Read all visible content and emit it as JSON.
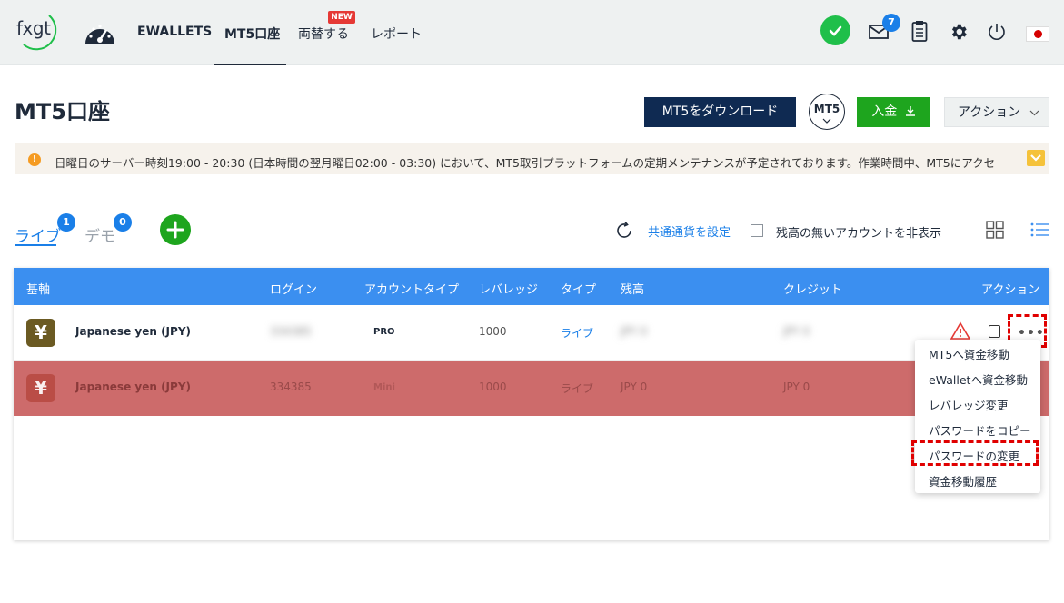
{
  "nav": {
    "logo_text": "fxgt",
    "items": [
      {
        "label": "EWALLETS"
      },
      {
        "label": "MT5口座"
      },
      {
        "label": "両替する"
      },
      {
        "label": "レポート"
      }
    ],
    "new_badge": "NEW",
    "mail_count": "7",
    "icons": [
      "dashboard-icon",
      "check-icon",
      "mail-icon",
      "clipboard-icon",
      "gear-icon",
      "power-icon",
      "japan-flag-icon"
    ]
  },
  "header": {
    "title": "MT5口座",
    "download_label": "MT5をダウンロード",
    "mt5_label": "MT5",
    "deposit_label": "入金",
    "action_label": "アクション"
  },
  "notice": {
    "text": "日曜日のサーバー時刻19:00 - 20:30 (日本時間の翌月曜日02:00 - 03:30) において、MT5取引プラットフォームの定期メンテナンスが予定されております。作業時間中、MT5にアクセ"
  },
  "tabs": {
    "live_label": "ライブ",
    "live_count": "1",
    "demo_label": "デモ",
    "demo_count": "0"
  },
  "toolbar": {
    "set_currency_label": "共通通貨を設定",
    "hide_empty_label": "残高の無いアカウントを非表示"
  },
  "table": {
    "headers": [
      "基軸",
      "ログイン",
      "アカウントタイプ",
      "レバレッジ",
      "タイプ",
      "残高",
      "クレジット",
      "アクション"
    ],
    "rows": [
      {
        "currency": "Japanese yen (JPY)",
        "login": "334385",
        "account_type": "PRO",
        "leverage": "1000",
        "type": "ライブ",
        "balance": "JPY 0",
        "credit": "JPY 0"
      },
      {
        "currency": "Japanese yen (JPY)",
        "login": "334385",
        "account_type": "Mini",
        "leverage": "1000",
        "type": "ライブ",
        "balance": "JPY 0",
        "credit": "JPY 0"
      }
    ],
    "yen_symbol": "¥",
    "dots": "•••"
  },
  "dropdown": {
    "items": [
      "MT5へ資金移動",
      "eWalletへ資金移動",
      "レバレッジ変更",
      "パスワードをコピー",
      "パスワードの変更",
      "資金移動履歴"
    ]
  },
  "colors": {
    "primary_blue": "#3b8ff0",
    "navy": "#0f2a52",
    "green": "#1ea51e",
    "yen_brown": "#6b5a22",
    "row_red": "#cd6b6b",
    "highlight": "#e00000"
  }
}
